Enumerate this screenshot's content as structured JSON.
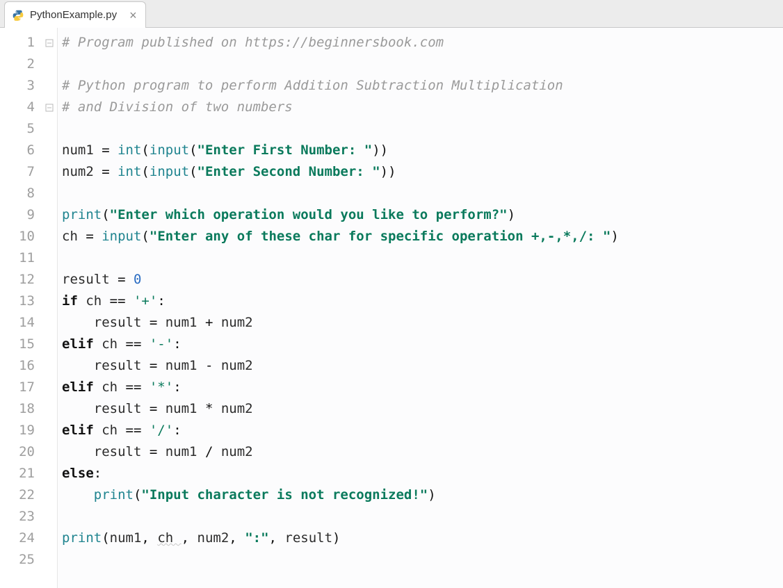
{
  "tab": {
    "filename": "PythonExample.py",
    "close_glyph": "×"
  },
  "gutter": {
    "start": 1,
    "end": 25
  },
  "fold_markers": {
    "1": "open",
    "4": "close"
  },
  "code_lines": [
    [
      {
        "t": "# Program published on https://beginnersbook.com",
        "c": "c-comment"
      }
    ],
    [],
    [
      {
        "t": "# Python program to perform Addition Subtraction Multiplication",
        "c": "c-comment"
      }
    ],
    [
      {
        "t": "# and Division of two numbers",
        "c": "c-comment"
      }
    ],
    [],
    [
      {
        "t": "num1 ",
        "c": "c-ident"
      },
      {
        "t": "= ",
        "c": "c-op"
      },
      {
        "t": "int",
        "c": "c-builtin"
      },
      {
        "t": "(",
        "c": "c-op"
      },
      {
        "t": "input",
        "c": "c-builtin"
      },
      {
        "t": "(",
        "c": "c-op"
      },
      {
        "t": "\"Enter First Number: \"",
        "c": "c-string"
      },
      {
        "t": "))",
        "c": "c-op"
      }
    ],
    [
      {
        "t": "num2 ",
        "c": "c-ident"
      },
      {
        "t": "= ",
        "c": "c-op"
      },
      {
        "t": "int",
        "c": "c-builtin"
      },
      {
        "t": "(",
        "c": "c-op"
      },
      {
        "t": "input",
        "c": "c-builtin"
      },
      {
        "t": "(",
        "c": "c-op"
      },
      {
        "t": "\"Enter Second Number: \"",
        "c": "c-string"
      },
      {
        "t": "))",
        "c": "c-op"
      }
    ],
    [],
    [
      {
        "t": "print",
        "c": "c-builtin"
      },
      {
        "t": "(",
        "c": "c-op"
      },
      {
        "t": "\"Enter which operation would you like to perform?\"",
        "c": "c-string"
      },
      {
        "t": ")",
        "c": "c-op"
      }
    ],
    [
      {
        "t": "ch ",
        "c": "c-ident"
      },
      {
        "t": "= ",
        "c": "c-op"
      },
      {
        "t": "input",
        "c": "c-builtin"
      },
      {
        "t": "(",
        "c": "c-op"
      },
      {
        "t": "\"Enter any of these char for specific operation +,-,*,/: \"",
        "c": "c-string"
      },
      {
        "t": ")",
        "c": "c-op"
      }
    ],
    [],
    [
      {
        "t": "result ",
        "c": "c-ident"
      },
      {
        "t": "= ",
        "c": "c-op"
      },
      {
        "t": "0",
        "c": "c-number"
      }
    ],
    [
      {
        "t": "if ",
        "c": "c-keyword"
      },
      {
        "t": "ch ",
        "c": "c-ident"
      },
      {
        "t": "== ",
        "c": "c-op"
      },
      {
        "t": "'+'",
        "c": "c-string-plain"
      },
      {
        "t": ":",
        "c": "c-op"
      }
    ],
    [
      {
        "t": "    result ",
        "c": "c-ident"
      },
      {
        "t": "= ",
        "c": "c-op"
      },
      {
        "t": "num1 ",
        "c": "c-ident"
      },
      {
        "t": "+ ",
        "c": "c-op"
      },
      {
        "t": "num2",
        "c": "c-ident"
      }
    ],
    [
      {
        "t": "elif ",
        "c": "c-keyword"
      },
      {
        "t": "ch ",
        "c": "c-ident"
      },
      {
        "t": "== ",
        "c": "c-op"
      },
      {
        "t": "'-'",
        "c": "c-string-plain"
      },
      {
        "t": ":",
        "c": "c-op"
      }
    ],
    [
      {
        "t": "    result ",
        "c": "c-ident"
      },
      {
        "t": "= ",
        "c": "c-op"
      },
      {
        "t": "num1 ",
        "c": "c-ident"
      },
      {
        "t": "- ",
        "c": "c-op"
      },
      {
        "t": "num2",
        "c": "c-ident"
      }
    ],
    [
      {
        "t": "elif ",
        "c": "c-keyword"
      },
      {
        "t": "ch ",
        "c": "c-ident"
      },
      {
        "t": "== ",
        "c": "c-op"
      },
      {
        "t": "'*'",
        "c": "c-string-plain"
      },
      {
        "t": ":",
        "c": "c-op"
      }
    ],
    [
      {
        "t": "    result ",
        "c": "c-ident"
      },
      {
        "t": "= ",
        "c": "c-op"
      },
      {
        "t": "num1 ",
        "c": "c-ident"
      },
      {
        "t": "* ",
        "c": "c-op"
      },
      {
        "t": "num2",
        "c": "c-ident"
      }
    ],
    [
      {
        "t": "elif ",
        "c": "c-keyword"
      },
      {
        "t": "ch ",
        "c": "c-ident"
      },
      {
        "t": "== ",
        "c": "c-op"
      },
      {
        "t": "'/'",
        "c": "c-string-plain"
      },
      {
        "t": ":",
        "c": "c-op"
      }
    ],
    [
      {
        "t": "    result ",
        "c": "c-ident"
      },
      {
        "t": "= ",
        "c": "c-op"
      },
      {
        "t": "num1 ",
        "c": "c-ident"
      },
      {
        "t": "/ ",
        "c": "c-op"
      },
      {
        "t": "num2",
        "c": "c-ident"
      }
    ],
    [
      {
        "t": "else",
        "c": "c-keyword"
      },
      {
        "t": ":",
        "c": "c-op"
      }
    ],
    [
      {
        "t": "    ",
        "c": "c-ident"
      },
      {
        "t": "print",
        "c": "c-builtin"
      },
      {
        "t": "(",
        "c": "c-op"
      },
      {
        "t": "\"Input character is not recognized!\"",
        "c": "c-string"
      },
      {
        "t": ")",
        "c": "c-op"
      }
    ],
    [],
    [
      {
        "t": "print",
        "c": "c-builtin"
      },
      {
        "t": "(",
        "c": "c-op"
      },
      {
        "t": "num1",
        "c": "c-ident"
      },
      {
        "t": ", ",
        "c": "c-op"
      },
      {
        "t": "ch ",
        "c": "c-ident",
        "wavy": true
      },
      {
        "t": ", ",
        "c": "c-op"
      },
      {
        "t": "num2",
        "c": "c-ident"
      },
      {
        "t": ", ",
        "c": "c-op"
      },
      {
        "t": "\":\"",
        "c": "c-string"
      },
      {
        "t": ", ",
        "c": "c-op"
      },
      {
        "t": "result",
        "c": "c-ident"
      },
      {
        "t": ")",
        "c": "c-op"
      }
    ],
    []
  ]
}
